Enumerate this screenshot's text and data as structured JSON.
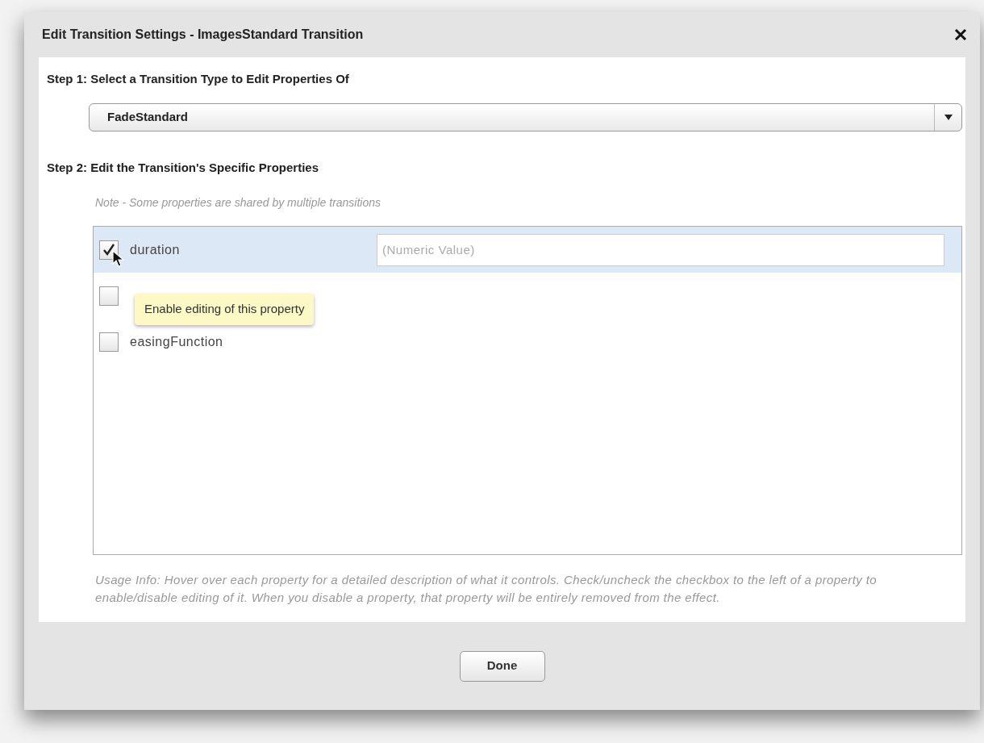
{
  "dialog": {
    "title": "Edit Transition Settings - ImagesStandard Transition",
    "step1": {
      "heading": "Step 1: Select a Transition Type to Edit Properties Of",
      "select_value": "FadeStandard"
    },
    "step2": {
      "heading": "Step 2: Edit the Transition's Specific Properties",
      "note": "Note - Some properties are shared by multiple transitions",
      "properties": [
        {
          "label": "duration",
          "checked": true,
          "selected": true,
          "placeholder": "(Numeric Value)"
        },
        {
          "checked": false,
          "selected": false
        },
        {
          "label": "easingFunction",
          "checked": false,
          "selected": false
        }
      ],
      "tooltip": "Enable editing of this property",
      "usage_info": "Usage Info: Hover over each property for a detailed description of what it controls.  Check/uncheck the checkbox to the left of a property to enable/disable editing of it.  When you disable a property, that property will be entirely removed from the effect."
    },
    "done_button": "Done"
  }
}
